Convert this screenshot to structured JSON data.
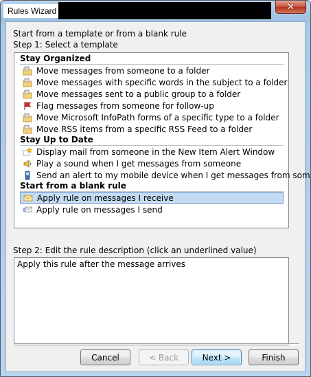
{
  "window": {
    "title": "Rules Wizard",
    "close_glyph": "✕"
  },
  "intro_text": "Start from a template or from a blank rule",
  "step1_label": "Step 1: Select a template",
  "template_groups": [
    {
      "header": "Stay Organized",
      "items": [
        {
          "label": "Move messages from someone to a folder",
          "icon": "move-folder-icon"
        },
        {
          "label": "Move messages with specific words in the subject to a folder",
          "icon": "move-folder-icon"
        },
        {
          "label": "Move messages sent to a public group to a folder",
          "icon": "move-folder-icon"
        },
        {
          "label": "Flag messages from someone for follow-up",
          "icon": "flag-icon"
        },
        {
          "label": "Move Microsoft InfoPath forms of a specific type to a folder",
          "icon": "move-folder-icon"
        },
        {
          "label": "Move RSS items from a specific RSS Feed to a folder",
          "icon": "move-folder-icon"
        }
      ]
    },
    {
      "header": "Stay Up to Date",
      "items": [
        {
          "label": "Display mail from someone in the New Item Alert Window",
          "icon": "alert-star-icon"
        },
        {
          "label": "Play a sound when I get messages from someone",
          "icon": "speaker-icon"
        },
        {
          "label": "Send an alert to my mobile device when I get messages from someone",
          "icon": "mobile-phone-icon"
        }
      ]
    },
    {
      "header": "Start from a blank rule",
      "items": [
        {
          "label": "Apply rule on messages I receive",
          "icon": "envelope-icon",
          "selected": true
        },
        {
          "label": "Apply rule on messages I send",
          "icon": "send-envelope-icon"
        }
      ]
    }
  ],
  "step2_label": "Step 2: Edit the rule description (click an underlined value)",
  "description_text": "Apply this rule after the message arrives",
  "buttons": {
    "cancel": "Cancel",
    "back": "< Back",
    "next": "Next >",
    "finish": "Finish"
  },
  "colors": {
    "selection": "#c5dbf3",
    "window_frame": "#b9d5ef",
    "close_button": "#c9543e"
  }
}
